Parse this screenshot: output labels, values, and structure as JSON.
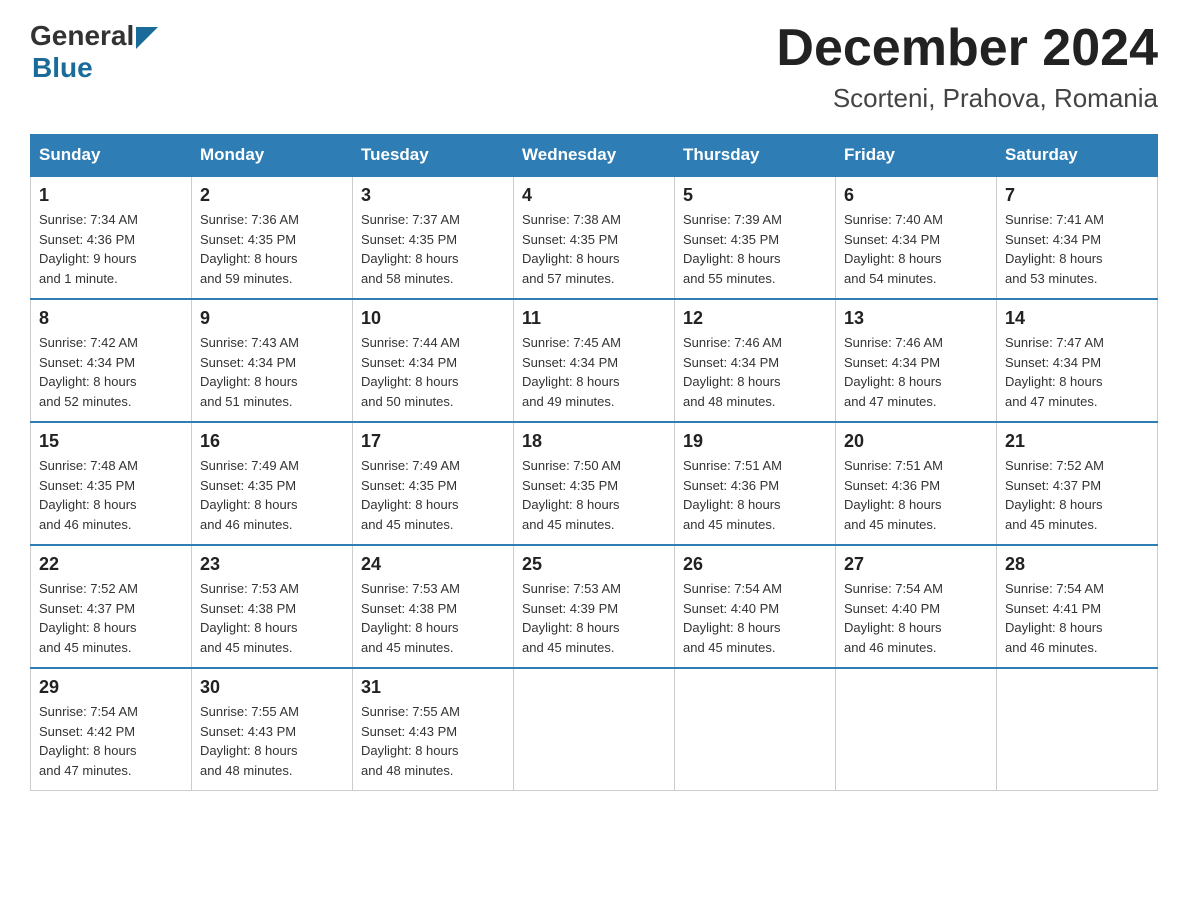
{
  "logo": {
    "general": "General",
    "blue": "Blue"
  },
  "title": "December 2024",
  "subtitle": "Scorteni, Prahova, Romania",
  "days_of_week": [
    "Sunday",
    "Monday",
    "Tuesday",
    "Wednesday",
    "Thursday",
    "Friday",
    "Saturday"
  ],
  "weeks": [
    [
      {
        "day": "1",
        "info": "Sunrise: 7:34 AM\nSunset: 4:36 PM\nDaylight: 9 hours\nand 1 minute."
      },
      {
        "day": "2",
        "info": "Sunrise: 7:36 AM\nSunset: 4:35 PM\nDaylight: 8 hours\nand 59 minutes."
      },
      {
        "day": "3",
        "info": "Sunrise: 7:37 AM\nSunset: 4:35 PM\nDaylight: 8 hours\nand 58 minutes."
      },
      {
        "day": "4",
        "info": "Sunrise: 7:38 AM\nSunset: 4:35 PM\nDaylight: 8 hours\nand 57 minutes."
      },
      {
        "day": "5",
        "info": "Sunrise: 7:39 AM\nSunset: 4:35 PM\nDaylight: 8 hours\nand 55 minutes."
      },
      {
        "day": "6",
        "info": "Sunrise: 7:40 AM\nSunset: 4:34 PM\nDaylight: 8 hours\nand 54 minutes."
      },
      {
        "day": "7",
        "info": "Sunrise: 7:41 AM\nSunset: 4:34 PM\nDaylight: 8 hours\nand 53 minutes."
      }
    ],
    [
      {
        "day": "8",
        "info": "Sunrise: 7:42 AM\nSunset: 4:34 PM\nDaylight: 8 hours\nand 52 minutes."
      },
      {
        "day": "9",
        "info": "Sunrise: 7:43 AM\nSunset: 4:34 PM\nDaylight: 8 hours\nand 51 minutes."
      },
      {
        "day": "10",
        "info": "Sunrise: 7:44 AM\nSunset: 4:34 PM\nDaylight: 8 hours\nand 50 minutes."
      },
      {
        "day": "11",
        "info": "Sunrise: 7:45 AM\nSunset: 4:34 PM\nDaylight: 8 hours\nand 49 minutes."
      },
      {
        "day": "12",
        "info": "Sunrise: 7:46 AM\nSunset: 4:34 PM\nDaylight: 8 hours\nand 48 minutes."
      },
      {
        "day": "13",
        "info": "Sunrise: 7:46 AM\nSunset: 4:34 PM\nDaylight: 8 hours\nand 47 minutes."
      },
      {
        "day": "14",
        "info": "Sunrise: 7:47 AM\nSunset: 4:34 PM\nDaylight: 8 hours\nand 47 minutes."
      }
    ],
    [
      {
        "day": "15",
        "info": "Sunrise: 7:48 AM\nSunset: 4:35 PM\nDaylight: 8 hours\nand 46 minutes."
      },
      {
        "day": "16",
        "info": "Sunrise: 7:49 AM\nSunset: 4:35 PM\nDaylight: 8 hours\nand 46 minutes."
      },
      {
        "day": "17",
        "info": "Sunrise: 7:49 AM\nSunset: 4:35 PM\nDaylight: 8 hours\nand 45 minutes."
      },
      {
        "day": "18",
        "info": "Sunrise: 7:50 AM\nSunset: 4:35 PM\nDaylight: 8 hours\nand 45 minutes."
      },
      {
        "day": "19",
        "info": "Sunrise: 7:51 AM\nSunset: 4:36 PM\nDaylight: 8 hours\nand 45 minutes."
      },
      {
        "day": "20",
        "info": "Sunrise: 7:51 AM\nSunset: 4:36 PM\nDaylight: 8 hours\nand 45 minutes."
      },
      {
        "day": "21",
        "info": "Sunrise: 7:52 AM\nSunset: 4:37 PM\nDaylight: 8 hours\nand 45 minutes."
      }
    ],
    [
      {
        "day": "22",
        "info": "Sunrise: 7:52 AM\nSunset: 4:37 PM\nDaylight: 8 hours\nand 45 minutes."
      },
      {
        "day": "23",
        "info": "Sunrise: 7:53 AM\nSunset: 4:38 PM\nDaylight: 8 hours\nand 45 minutes."
      },
      {
        "day": "24",
        "info": "Sunrise: 7:53 AM\nSunset: 4:38 PM\nDaylight: 8 hours\nand 45 minutes."
      },
      {
        "day": "25",
        "info": "Sunrise: 7:53 AM\nSunset: 4:39 PM\nDaylight: 8 hours\nand 45 minutes."
      },
      {
        "day": "26",
        "info": "Sunrise: 7:54 AM\nSunset: 4:40 PM\nDaylight: 8 hours\nand 45 minutes."
      },
      {
        "day": "27",
        "info": "Sunrise: 7:54 AM\nSunset: 4:40 PM\nDaylight: 8 hours\nand 46 minutes."
      },
      {
        "day": "28",
        "info": "Sunrise: 7:54 AM\nSunset: 4:41 PM\nDaylight: 8 hours\nand 46 minutes."
      }
    ],
    [
      {
        "day": "29",
        "info": "Sunrise: 7:54 AM\nSunset: 4:42 PM\nDaylight: 8 hours\nand 47 minutes."
      },
      {
        "day": "30",
        "info": "Sunrise: 7:55 AM\nSunset: 4:43 PM\nDaylight: 8 hours\nand 48 minutes."
      },
      {
        "day": "31",
        "info": "Sunrise: 7:55 AM\nSunset: 4:43 PM\nDaylight: 8 hours\nand 48 minutes."
      },
      null,
      null,
      null,
      null
    ]
  ]
}
